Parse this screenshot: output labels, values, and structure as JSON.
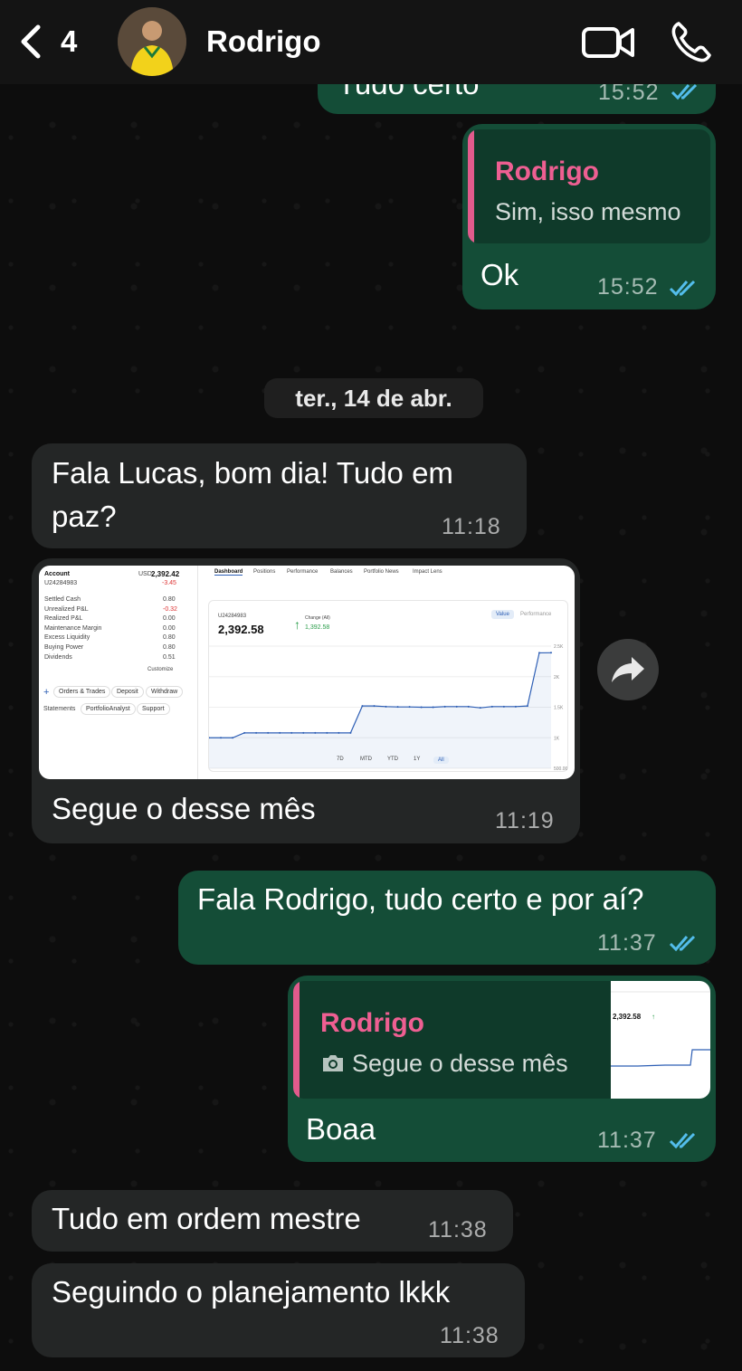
{
  "header": {
    "back_count": "4",
    "contact_name": "Rodrigo"
  },
  "messages": {
    "m0": {
      "text": "Tudo certo",
      "time": "15:52"
    },
    "m1": {
      "quote_name": "Rodrigo",
      "quote_text": "Sim, isso mesmo",
      "text": "Ok",
      "time": "15:52"
    },
    "date_divider": "ter., 14 de abr.",
    "m2": {
      "line1": "Fala Lucas, bom dia! Tudo em",
      "line2": "paz?",
      "time": "11:18"
    },
    "m3": {
      "caption": "Segue o desse mês",
      "time": "11:19"
    },
    "m4": {
      "text": "Fala Rodrigo, tudo certo e por aí?",
      "time": "11:37"
    },
    "m5": {
      "quote_name": "Rodrigo",
      "quote_text": "Segue o desse mês",
      "text": "Boaa",
      "time": "11:37"
    },
    "m6": {
      "text": "Tudo em ordem mestre",
      "time": "11:38"
    },
    "m7": {
      "text": "Seguindo o planejamento lkkk",
      "time": "11:38"
    }
  },
  "screenshot": {
    "account_label": "Account",
    "account_id": "U24284983",
    "currency": "USD",
    "balance": "2,392.42",
    "change": "-3.45",
    "rows": [
      {
        "label": "Settled Cash",
        "value": "0.80"
      },
      {
        "label": "Unrealized P&L",
        "value": "-0.32"
      },
      {
        "label": "Realized P&L",
        "value": "0.00"
      },
      {
        "label": "Maintenance Margin",
        "value": "0.00"
      },
      {
        "label": "Excess Liquidity",
        "value": "0.80"
      },
      {
        "label": "Buying Power",
        "value": "0.80"
      },
      {
        "label": "Dividends",
        "value": "0.51"
      }
    ],
    "customize": "Customize",
    "actions": [
      "Orders & Trades",
      "Deposit",
      "Withdraw"
    ],
    "links": [
      "Statements",
      "PortfolioAnalyst",
      "Support"
    ],
    "tabs": [
      "Dashboard",
      "Positions",
      "Performance",
      "Balances",
      "Portfolio News",
      "Impact Lens"
    ],
    "chart_id": "U24284983",
    "chart_value": "2,392.58",
    "change_label": "Change (All)",
    "change_value": "1,392.58",
    "toggle_value": "Value",
    "toggle_perf": "Performance",
    "ranges": [
      "7D",
      "MTD",
      "YTD",
      "1Y",
      "All"
    ],
    "y_ticks": [
      "2.5K",
      "2K",
      "1.5K",
      "1K",
      "500.00"
    ],
    "chart_data": {
      "type": "line",
      "values": [
        1000,
        1000,
        1000,
        1080,
        1080,
        1080,
        1080,
        1080,
        1080,
        1080,
        1080,
        1080,
        1080,
        1520,
        1520,
        1510,
        1505,
        1505,
        1500,
        1500,
        1510,
        1510,
        1510,
        1490,
        1510,
        1510,
        1510,
        1520,
        2390,
        2392
      ],
      "ylim": [
        500,
        2500
      ]
    }
  }
}
